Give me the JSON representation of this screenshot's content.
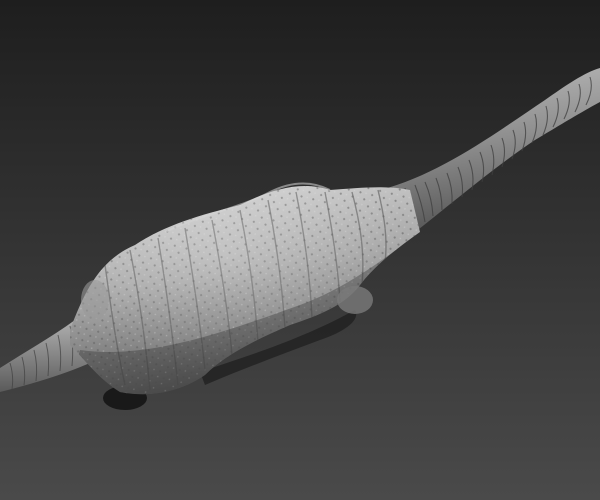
{
  "scene": {
    "subject": "sculpted-organic-form",
    "colors": {
      "background_top": "#1e1e1e",
      "background_bottom": "#4a4a4a",
      "surface_light": "#bdbdbd",
      "surface_mid": "#8a8a8a",
      "surface_dark": "#4d4d4d",
      "shadow": "#151515"
    }
  }
}
